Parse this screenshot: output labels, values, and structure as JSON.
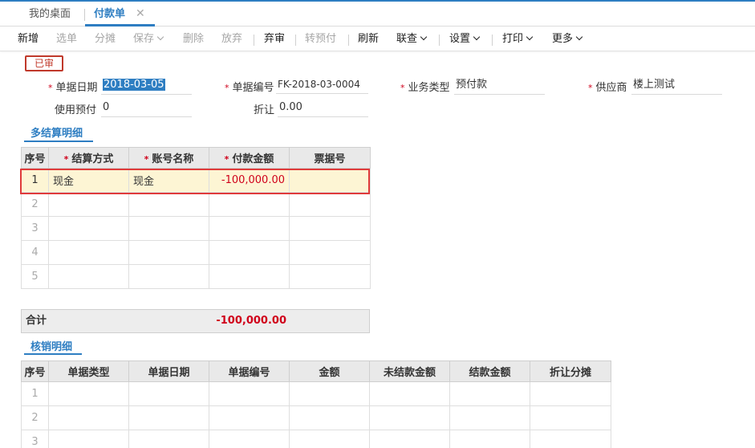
{
  "tabs": {
    "home": "我的桌面",
    "active": "付款单",
    "close": "✕"
  },
  "toolbar": {
    "new": "新增",
    "select": "选单",
    "split": "分摊",
    "save": "保存",
    "delete": "删除",
    "abandon": "放弃",
    "unaudit": "弃审",
    "to_prepay": "转预付",
    "refresh": "刷新",
    "link": "联查",
    "settings": "设置",
    "print": "打印",
    "more": "更多"
  },
  "status": "已审",
  "form": {
    "req_mark": "*",
    "doc_date_label": "单据日期",
    "doc_date": "2018-03-05",
    "doc_no_label": "单据编号",
    "doc_no": "FK-2018-03-0004",
    "biz_type_label": "业务类型",
    "biz_type": "预付款",
    "supplier_label": "供应商",
    "supplier": "楼上测试",
    "use_prepay_label": "使用预付",
    "use_prepay": "0",
    "discount_label": "折让",
    "discount": "0.00"
  },
  "settlement": {
    "title": "多结算明细",
    "headers": [
      "序号",
      "结算方式",
      "账号名称",
      "付款金额",
      "票据号"
    ],
    "rows": [
      {
        "idx": "1",
        "method": "现金",
        "account": "现金",
        "amount": "-100,000.00",
        "bill": ""
      },
      {
        "idx": "2",
        "method": "",
        "account": "",
        "amount": "",
        "bill": ""
      },
      {
        "idx": "3",
        "method": "",
        "account": "",
        "amount": "",
        "bill": ""
      },
      {
        "idx": "4",
        "method": "",
        "account": "",
        "amount": "",
        "bill": ""
      },
      {
        "idx": "5",
        "method": "",
        "account": "",
        "amount": "",
        "bill": ""
      }
    ],
    "total_label": "合计",
    "total_value": "-100,000.00"
  },
  "writeoff": {
    "title": "核销明细",
    "headers": [
      "序号",
      "单据类型",
      "单据日期",
      "单据编号",
      "金额",
      "未结款金额",
      "结款金额",
      "折让分摊"
    ],
    "rows": [
      {
        "idx": "1"
      },
      {
        "idx": "2"
      },
      {
        "idx": "3"
      }
    ]
  },
  "colors": {
    "accent": "#2e7ec2",
    "danger": "#d0021b",
    "highlight_row": "#fdf5d4",
    "highlight_border": "#e03b3b"
  }
}
